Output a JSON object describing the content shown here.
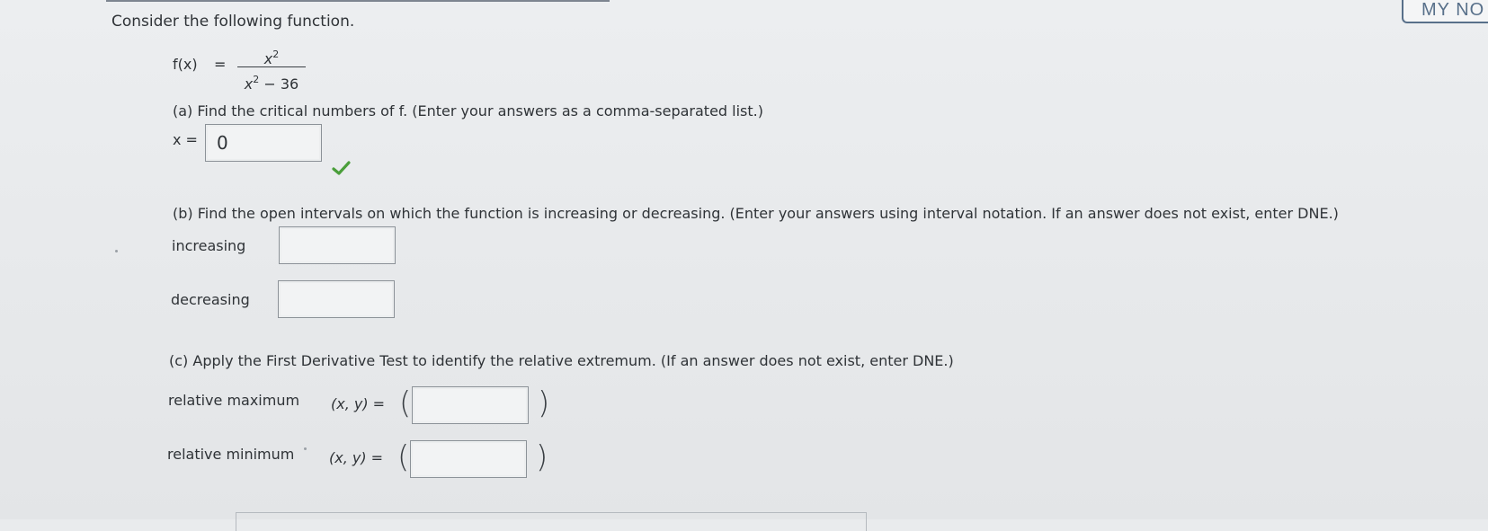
{
  "header": {
    "notes_button_label": "MY NO"
  },
  "question": {
    "prompt": "Consider the following function.",
    "function_name": "f(x)",
    "equals": "=",
    "numerator_base": "x",
    "numerator_exp": "2",
    "denominator_base": "x",
    "denominator_exp": "2",
    "denominator_rest": " − 36"
  },
  "part_a": {
    "text": "(a) Find the critical numbers of f. (Enter your answers as a comma-separated list.)",
    "var_label": "x =",
    "answer_value": "0",
    "status": "correct"
  },
  "part_b": {
    "text": "(b) Find the open intervals on which the function is increasing or decreasing. (Enter your answers using interval notation. If an answer does not exist, enter DNE.)",
    "increasing_label": "increasing",
    "increasing_value": "",
    "decreasing_label": "decreasing",
    "decreasing_value": ""
  },
  "part_c": {
    "text": "(c) Apply the First Derivative Test to identify the relative extremum. (If an answer does not exist, enter DNE.)",
    "max_label": "relative maximum",
    "max_coord_label": "(x, y) =",
    "max_value": "",
    "min_label": "relative minimum",
    "min_coord_label": "(x, y) =",
    "min_value": "",
    "open_paren": "(",
    "close_paren": ")"
  },
  "colors": {
    "correct_check": "#4a9e3a",
    "notes_accent": "#58708a"
  },
  "icons": {
    "correct": "checkmark-icon"
  }
}
